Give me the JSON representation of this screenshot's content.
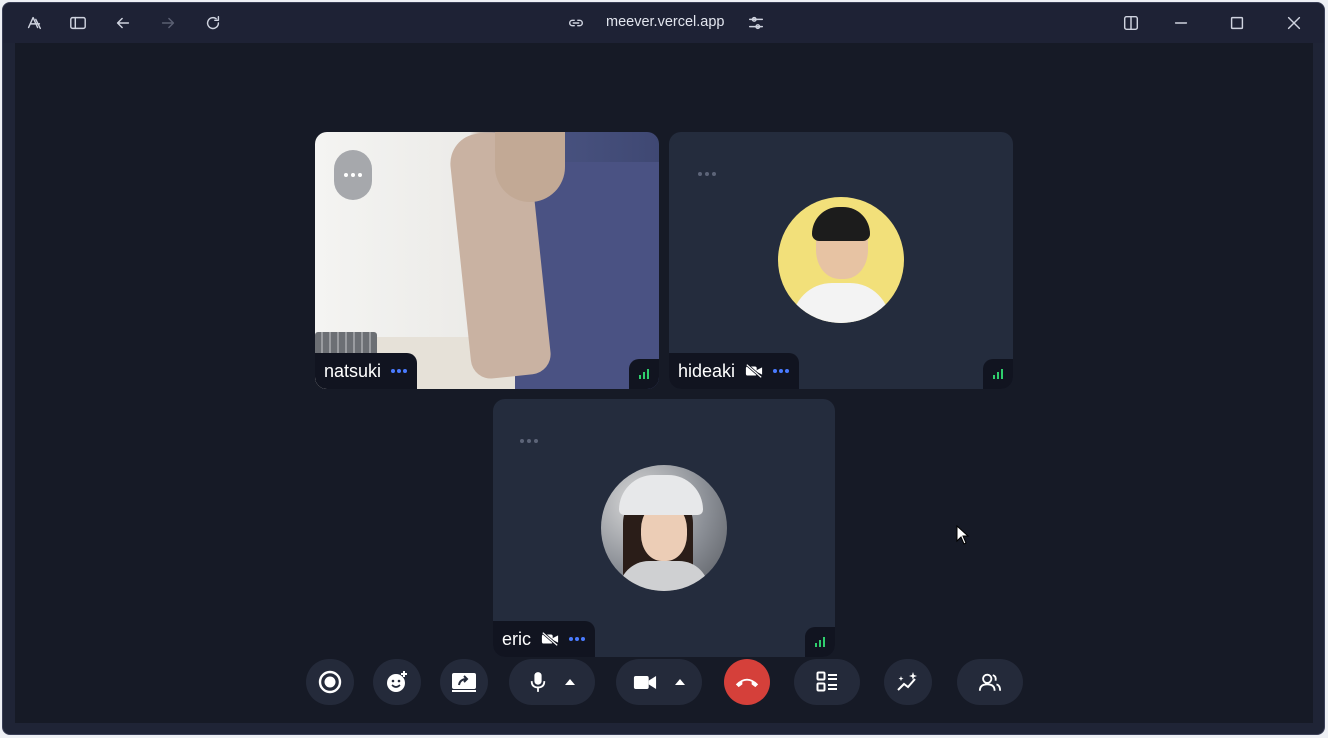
{
  "browser": {
    "url": "meever.vercel.app",
    "icons": [
      "app-logo-icon",
      "sidebar-toggle-icon",
      "back-icon",
      "forward-icon",
      "reload-icon",
      "link-icon",
      "site-settings-icon",
      "split-view-icon",
      "minimize-icon",
      "maximize-icon",
      "close-icon"
    ]
  },
  "participants": [
    {
      "name": "natsuki",
      "camera": "on",
      "signal": "good"
    },
    {
      "name": "hideaki",
      "camera": "off",
      "signal": "good"
    },
    {
      "name": "eric",
      "camera": "off",
      "signal": "good"
    }
  ],
  "controls": {
    "buttons": [
      "record-icon",
      "reactions-icon",
      "share-screen-icon",
      "microphone-icon",
      "camera-icon",
      "hang-up-icon",
      "layout-icon",
      "effects-icon",
      "participants-icon"
    ]
  },
  "colors": {
    "background": "#161a26",
    "tile": "#242c3d",
    "accent": "#4a7bff",
    "signal": "#2fce6d",
    "hangup": "#d5403a"
  }
}
